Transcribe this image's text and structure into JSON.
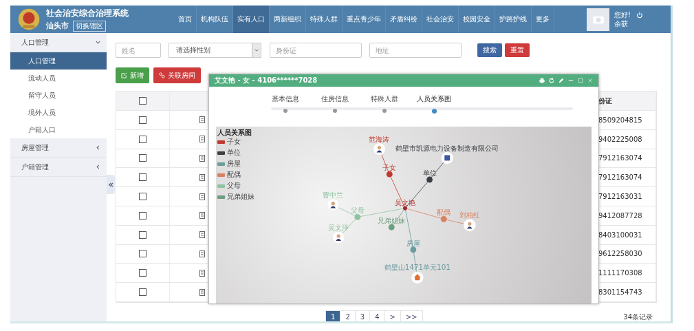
{
  "header": {
    "title": "社会治安综合治理系统",
    "city": "汕头市",
    "switch_button": "切换辖区",
    "greeting": "您好!",
    "user": "余获"
  },
  "nav": [
    {
      "label": "首页",
      "selected": false
    },
    {
      "label": "机构队伍",
      "selected": false
    },
    {
      "label": "实有人口",
      "selected": true
    },
    {
      "label": "两新组织",
      "selected": false
    },
    {
      "label": "特殊人群",
      "selected": false
    },
    {
      "label": "重点青少年",
      "selected": false
    },
    {
      "label": "矛盾纠纷",
      "selected": false
    },
    {
      "label": "社会治安",
      "selected": false
    },
    {
      "label": "校园安全",
      "selected": false
    },
    {
      "label": "护路护线",
      "selected": false
    },
    {
      "label": "更多",
      "selected": false
    }
  ],
  "sidebar": [
    {
      "label": "人口管理",
      "expanded": true,
      "children": [
        {
          "label": "人口管理",
          "selected": true
        },
        {
          "label": "流动人员",
          "selected": false
        },
        {
          "label": "留守人员",
          "selected": false
        },
        {
          "label": "境外人员",
          "selected": false
        },
        {
          "label": "户籍人口",
          "selected": false
        }
      ]
    },
    {
      "label": "房屋管理",
      "expanded": false
    },
    {
      "label": "户籍管理",
      "expanded": false
    }
  ],
  "search": {
    "name_placeholder": "姓名",
    "gender_select": "请选择性别",
    "id_placeholder": "身份证",
    "address_placeholder": "地址",
    "search_button": "搜索",
    "reset_button": "重置"
  },
  "actions": {
    "add": "新增",
    "link_room": "关联房间"
  },
  "table": {
    "header_checked": false,
    "id_column": "份证",
    "rows": [
      {
        "checked": false,
        "id": "8509204815"
      },
      {
        "checked": false,
        "id": "9402225008"
      },
      {
        "checked": false,
        "id": "7912163074"
      },
      {
        "checked": false,
        "id": "7912163074"
      },
      {
        "checked": false,
        "id": "7912163031"
      },
      {
        "checked": false,
        "id": "9412087728"
      },
      {
        "checked": false,
        "id": "8403100031"
      },
      {
        "checked": false,
        "id": "9612258030"
      },
      {
        "checked": false,
        "id": "1111170308"
      },
      {
        "checked": false,
        "id": "8301154743"
      }
    ]
  },
  "pagination": {
    "pages": [
      {
        "label": "1",
        "selected": true
      },
      {
        "label": "2",
        "selected": false
      },
      {
        "label": "3",
        "selected": false
      },
      {
        "label": "4",
        "selected": false
      },
      {
        "label": ">",
        "selected": false
      },
      {
        "label": ">>",
        "selected": false
      }
    ],
    "total": "34条记录"
  },
  "modal": {
    "title": "艾文艳 - 女 - 4106******7028",
    "steps": [
      {
        "label": "基本信息",
        "selected": false
      },
      {
        "label": "住房信息",
        "selected": false
      },
      {
        "label": "特殊人群",
        "selected": false
      },
      {
        "label": "人员关系图",
        "selected": true
      }
    ],
    "graph": {
      "title": "人员关系图",
      "legend": [
        {
          "label": "子女",
          "color": "#c0392b"
        },
        {
          "label": "单位",
          "color": "#3a3f44"
        },
        {
          "label": "房屋",
          "color": "#6a9c9e"
        },
        {
          "label": "配偶",
          "color": "#d9805f"
        },
        {
          "label": "父母",
          "color": "#8fc3a0"
        },
        {
          "label": "兄弟姐妹",
          "color": "#6e9e80"
        }
      ],
      "center": "吴文艳",
      "relations": [
        {
          "label": "子女",
          "color": "#c0392b",
          "children": [
            {
              "label": "范海涛",
              "kind": "person"
            }
          ]
        },
        {
          "label": "单位",
          "color": "#3a3f44",
          "children": [
            {
              "label": "鹤壁市凯源电力设备制造有限公司",
              "kind": "company"
            }
          ]
        },
        {
          "label": "父母",
          "color": "#8fc3a0",
          "children": [
            {
              "label": "曹中兰",
              "kind": "person"
            },
            {
              "label": "吴文洋",
              "kind": "person"
            }
          ]
        },
        {
          "label": "兄弟姐妹",
          "color": "#6e9e80"
        },
        {
          "label": "配偶",
          "color": "#d9805f",
          "children": [
            {
              "label": "刘柏红",
              "kind": "person"
            }
          ]
        },
        {
          "label": "房屋",
          "color": "#6a9c9e",
          "children": [
            {
              "label": "鹤壁山1471单元101",
              "kind": "house"
            }
          ]
        }
      ]
    }
  }
}
